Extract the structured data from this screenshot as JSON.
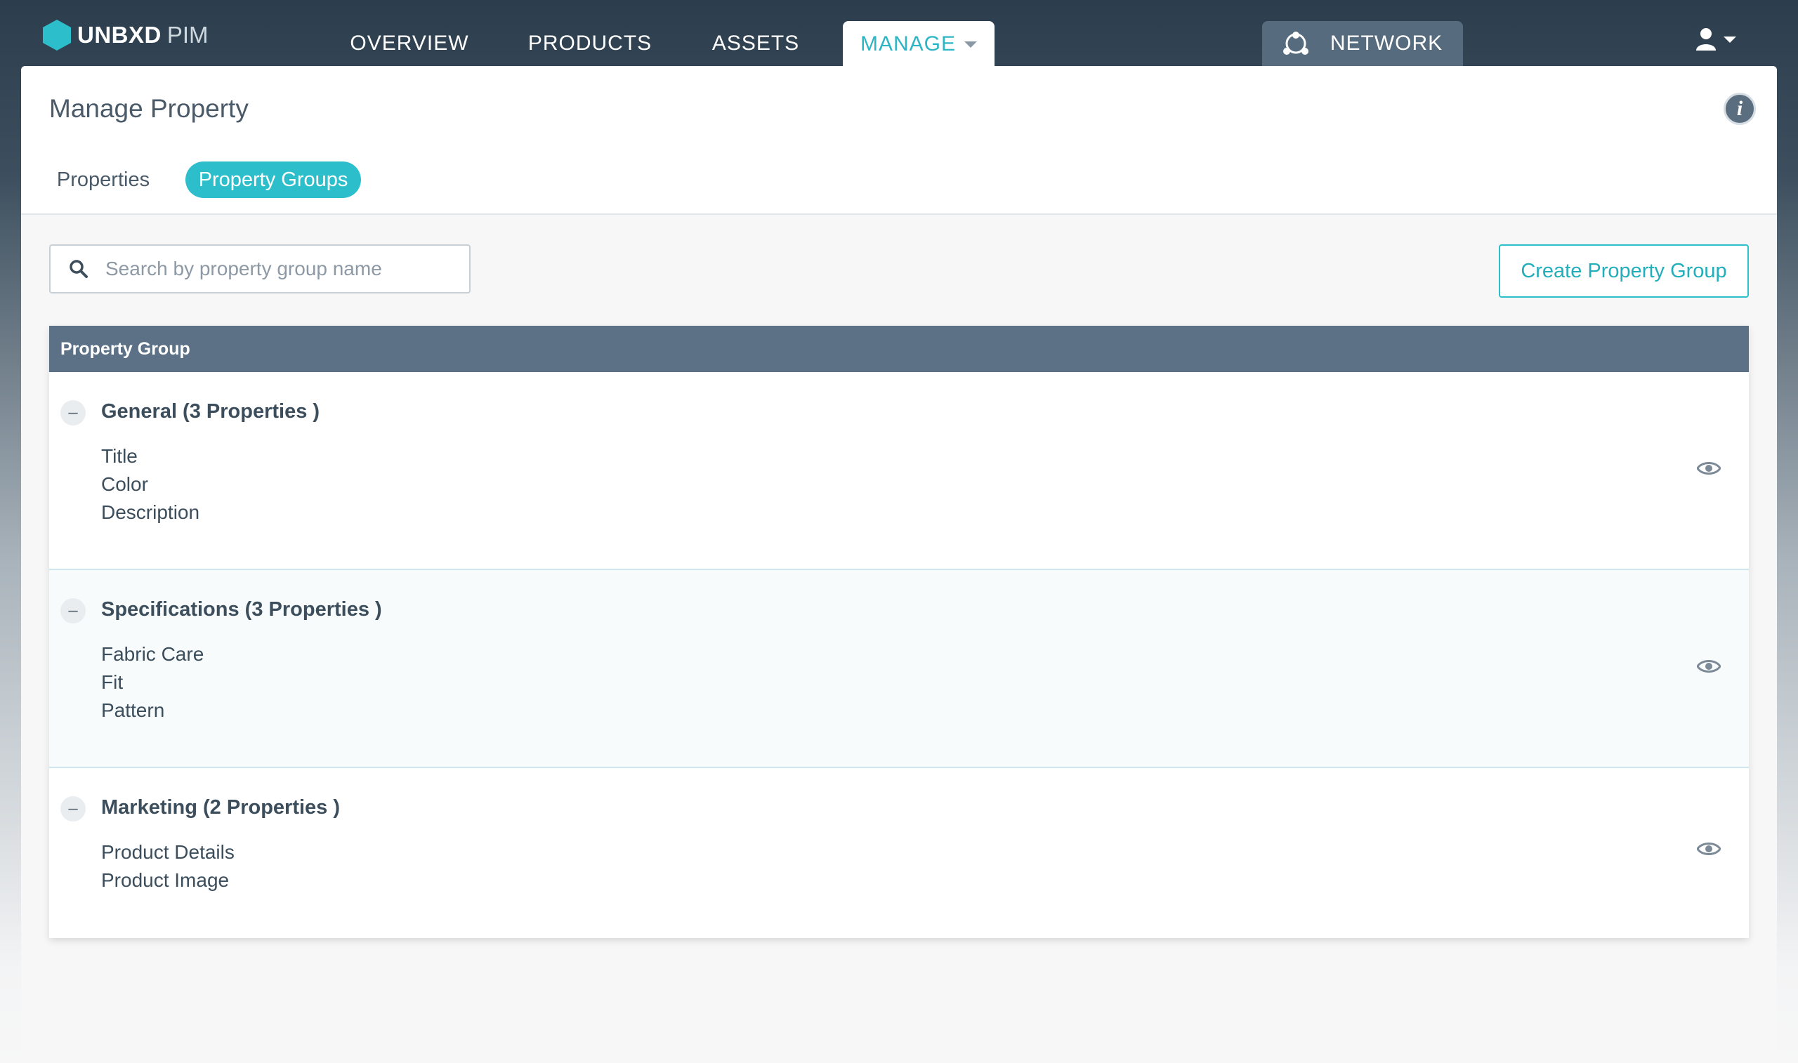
{
  "brand": {
    "name": "UNBXD",
    "suffix": "PIM",
    "color": "#2cbfcb"
  },
  "nav": {
    "overview": "OVERVIEW",
    "products": "PRODUCTS",
    "assets": "ASSETS",
    "manage": "MANAGE",
    "network": "NETWORK",
    "active": "MANAGE"
  },
  "page": {
    "title": "Manage Property",
    "tabs": {
      "properties": "Properties",
      "groups": "Property Groups",
      "active": "Property Groups"
    }
  },
  "search": {
    "placeholder": "Search by property group name",
    "value": ""
  },
  "actions": {
    "create": "Create Property Group"
  },
  "table": {
    "header": "Property Group",
    "groups": [
      {
        "title": "General (3 Properties )",
        "properties": [
          "Title",
          "Color",
          "Description"
        ]
      },
      {
        "title": "Specifications (3 Properties )",
        "properties": [
          "Fabric Care",
          "Fit",
          "Pattern"
        ]
      },
      {
        "title": "Marketing (2 Properties )",
        "properties": [
          "Product Details",
          "Product Image"
        ]
      }
    ]
  },
  "icons": {
    "logo": "hexagon-logo-icon",
    "network": "network-icon",
    "user": "user-icon",
    "info": "info-icon",
    "search": "search-icon",
    "collapse": "minus-icon",
    "view": "eye-icon"
  },
  "colors": {
    "accent": "#2cbfcb",
    "nav_bg": "#2c3e4d",
    "table_header": "#5c7186"
  }
}
